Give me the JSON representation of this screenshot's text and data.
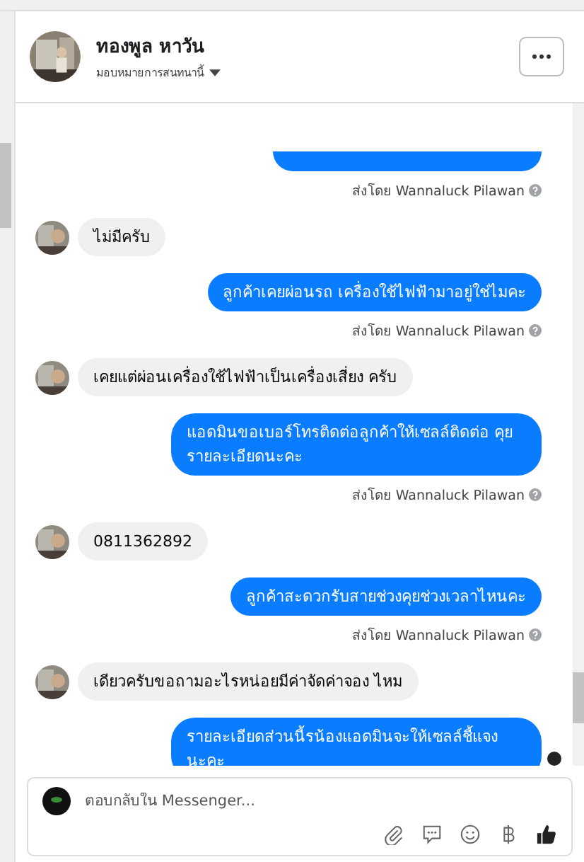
{
  "header": {
    "name": "ทองพูล หาวัน",
    "subtitle": "มอบหมายการสนทนานี้"
  },
  "messages": [
    {
      "kind": "outgoing",
      "note": "ส่งโดย Wannaluck Pilawan"
    },
    {
      "kind": "incoming",
      "text": "ไม่มีครับ"
    },
    {
      "kind": "outgoing",
      "text": "ลูกค้าเคยผ่อนรถ เครื่องใช้ไฟฟ้ามาอยู่ใช่ไมคะ",
      "note": "ส่งโดย Wannaluck Pilawan"
    },
    {
      "kind": "incoming",
      "text": "เคยแต่ผ่อนเครื่องใช้ไฟฟ้าเป็นเครื่องเสี่ยง ครับ"
    },
    {
      "kind": "outgoing",
      "text": "แอดมินขอเบอร์โทรติดต่อลูกค้าให้เซลล์ติดต่อ คุยรายละเอียดนะคะ",
      "note": "ส่งโดย Wannaluck Pilawan"
    },
    {
      "kind": "incoming",
      "text": "0811362892"
    },
    {
      "kind": "outgoing",
      "text": "ลูกค้าสะดวกรับสายช่วงคุยช่วงเวลาไหนคะ",
      "note": "ส่งโดย Wannaluck Pilawan"
    },
    {
      "kind": "incoming",
      "text": "เดียวครับขอถามอะไรหน่อยมีค่าจัดค่าจอง ไหม"
    },
    {
      "kind": "outgoing",
      "text": "รายละเอียดส่วนนี้รน้องแอดมินจะให้เซลล์ชี้แจง นะคะ",
      "seen": true
    }
  ],
  "composer": {
    "placeholder": "ตอบกลับใน Messenger..."
  }
}
